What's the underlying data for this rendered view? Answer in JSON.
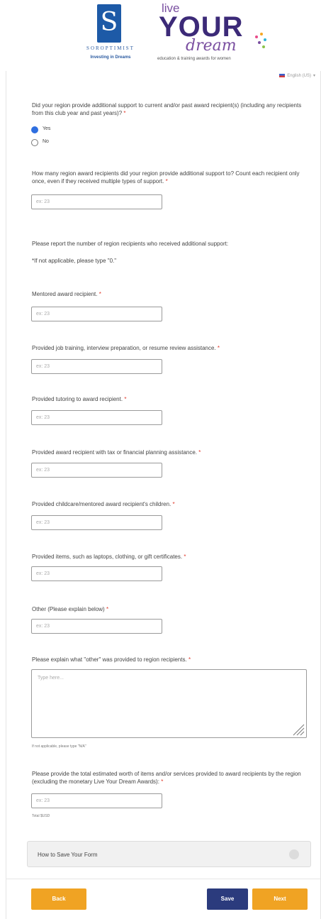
{
  "header": {
    "soroptimist_mark": "S",
    "soroptimist_name": "SOROPTIMIST",
    "soroptimist_tagline": "Investing in Dreams",
    "lyd_live": "live",
    "lyd_your": "YOUR",
    "lyd_dream": "dream",
    "lyd_subtitle": "education & training awards for women"
  },
  "language": {
    "label": "English (US)"
  },
  "questions": {
    "q1": {
      "text": "Did your region provide additional support to current and/or past award recipient(s) (including any recipients from this club year and past years)?",
      "required": "*"
    },
    "q1_options": [
      {
        "label": "Yes",
        "selected": true
      },
      {
        "label": "No",
        "selected": false
      }
    ],
    "q2": {
      "text": "How many region award recipients did your region provide additional support to? Count each recipient only once, even if they received multiple types of support.",
      "required": "*",
      "placeholder": "ex: 23"
    },
    "intro": "Please report the number of region recipients who received additional support:",
    "intro_note": "*If not applicable, please type \"0.\"",
    "q3": {
      "text": "Mentored award recipient.",
      "required": "*",
      "placeholder": "ex: 23"
    },
    "q4": {
      "text": "Provided job training, interview preparation, or resume review assistance.",
      "required": "*",
      "placeholder": "ex: 23"
    },
    "q5": {
      "text": "Provided tutoring to award recipient.",
      "required": "*",
      "placeholder": "ex: 23"
    },
    "q6": {
      "text": "Provided award recipient with tax or financial planning assistance.",
      "required": "*",
      "placeholder": "ex: 23"
    },
    "q7": {
      "text": "Provided childcare/mentored award recipient's children.",
      "required": "*",
      "placeholder": "ex: 23"
    },
    "q8": {
      "text": "Provided items, such as laptops, clothing, or gift certificates.",
      "required": "*",
      "placeholder": "ex: 23"
    },
    "q9": {
      "text": "Other (Please explain below)",
      "required": "*",
      "placeholder": "ex: 23"
    },
    "q10": {
      "text": "Please explain what \"other\" was provided to region recipients.",
      "required": "*",
      "placeholder": "Type here...",
      "help": "If not applicable, please type \"N/A\""
    },
    "q11": {
      "text": "Please provide the total estimated worth of items and/or services provided to award recipients by the region (excluding the monetary Live Your Dream Awards):",
      "required": "*",
      "placeholder": "ex: 23",
      "help": "Total $USD"
    }
  },
  "accordion": {
    "label": "How to Save Your Form"
  },
  "buttons": {
    "back": "Back",
    "save": "Save",
    "next": "Next"
  },
  "colors": {
    "accent_orange": "#f0a323",
    "save_navy": "#2b3b7d",
    "radio_blue": "#2f6fe0",
    "required_red": "#e0392b"
  }
}
